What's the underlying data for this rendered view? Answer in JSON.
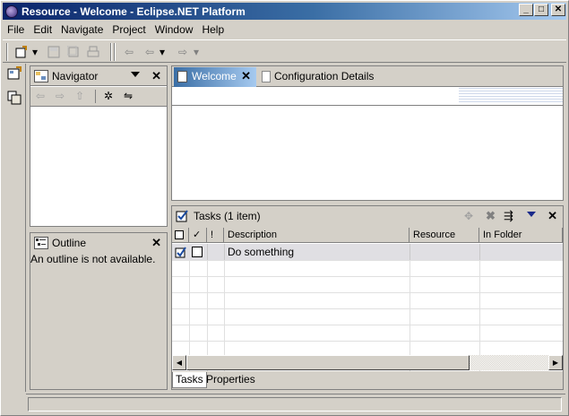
{
  "window": {
    "title": "Resource - Welcome - Eclipse.NET Platform",
    "buttons": {
      "minimize": "_",
      "maximize": "□",
      "close": "✕"
    }
  },
  "menubar": {
    "items": [
      {
        "label": "File"
      },
      {
        "label": "Edit"
      },
      {
        "label": "Navigate"
      },
      {
        "label": "Project"
      },
      {
        "label": "Window"
      },
      {
        "label": "Help"
      }
    ]
  },
  "navigator": {
    "title": "Navigator",
    "close": "✕"
  },
  "outline": {
    "title": "Outline",
    "close": "✕",
    "message": "An outline is not available."
  },
  "editor": {
    "tabs": [
      {
        "label": "Welcome"
      },
      {
        "label": "Configuration Details"
      }
    ],
    "close": "✕"
  },
  "tasks": {
    "title": "Tasks (1 item)",
    "close": "✕",
    "columns": [
      "",
      "✓",
      "!",
      "Description",
      "Resource",
      "In Folder"
    ],
    "rows": [
      {
        "description": "Do something",
        "resource": "",
        "folder": ""
      }
    ],
    "bottom_tabs": [
      {
        "label": "Tasks"
      },
      {
        "label": "Properties"
      }
    ]
  },
  "colors": {
    "title_start": "#0a246a",
    "title_end": "#a6caf0",
    "face": "#d4d0c8",
    "active_tab": "#3a6ea5"
  }
}
